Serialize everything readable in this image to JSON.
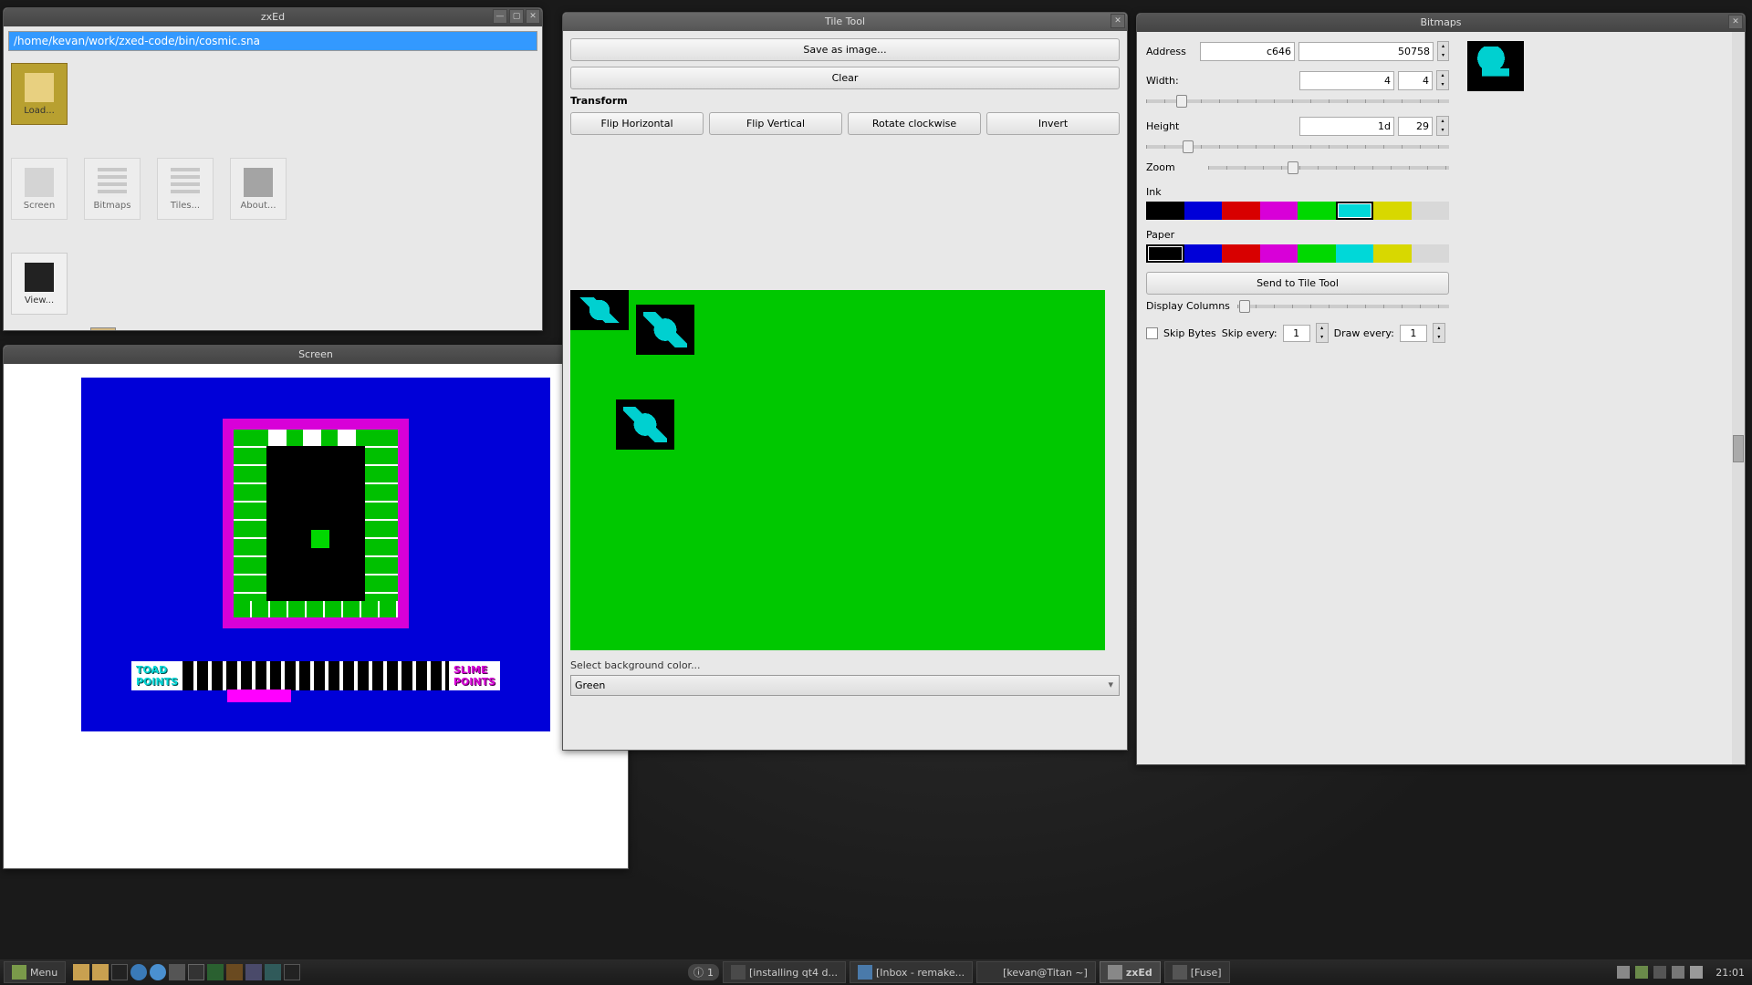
{
  "zxed": {
    "title": "zxEd",
    "path": "/home/kevan/work/zxed-code/bin/cosmic.sna",
    "tools": {
      "load": "Load...",
      "screen": "Screen",
      "bitmaps": "Bitmaps",
      "tiles": "Tiles...",
      "about": "About...",
      "view": "View..."
    }
  },
  "screen": {
    "title": "Screen",
    "hud_left_1": "TOAD",
    "hud_left_2": "POINTS",
    "hud_right_1": "SLIME",
    "hud_right_2": "POINTS"
  },
  "tile": {
    "title": "Tile Tool",
    "save": "Save as image...",
    "clear": "Clear",
    "transform": "Transform",
    "flip_h": "Flip Horizontal",
    "flip_v": "Flip Vertical",
    "rotate": "Rotate clockwise",
    "invert": "Invert",
    "bg_label": "Select background color...",
    "bg_value": "Green"
  },
  "bitmaps": {
    "title": "Bitmaps",
    "address_label": "Address",
    "address_hex": "c646",
    "address_dec": "50758",
    "width_label": "Width:",
    "width_hex": "4",
    "width_dec": "4",
    "height_label": "Height",
    "height_hex": "1d",
    "height_dec": "29",
    "zoom_label": "Zoom",
    "ink_label": "Ink",
    "paper_label": "Paper",
    "send": "Send to Tile Tool",
    "disp_cols": "Display Columns",
    "skip_bytes": "Skip Bytes",
    "skip_every": "Skip every:",
    "skip_val": "1",
    "draw_every": "Draw every:",
    "draw_val": "1",
    "palette": [
      "#000000",
      "#0000d8",
      "#d80000",
      "#d800d8",
      "#00d800",
      "#00d8d8",
      "#d8d800",
      "#d8d8d8"
    ],
    "ink_selected": 5,
    "paper_selected": 0
  },
  "taskbar": {
    "menu": "Menu",
    "notif_count": "1",
    "items": [
      {
        "label": "[installing qt4 d...",
        "active": false
      },
      {
        "label": "[Inbox - remake...",
        "active": false
      },
      {
        "label": "[kevan@Titan ~]",
        "active": false
      },
      {
        "label": "zxEd",
        "active": true
      },
      {
        "label": "[Fuse]",
        "active": false
      }
    ],
    "clock": "21:01"
  }
}
